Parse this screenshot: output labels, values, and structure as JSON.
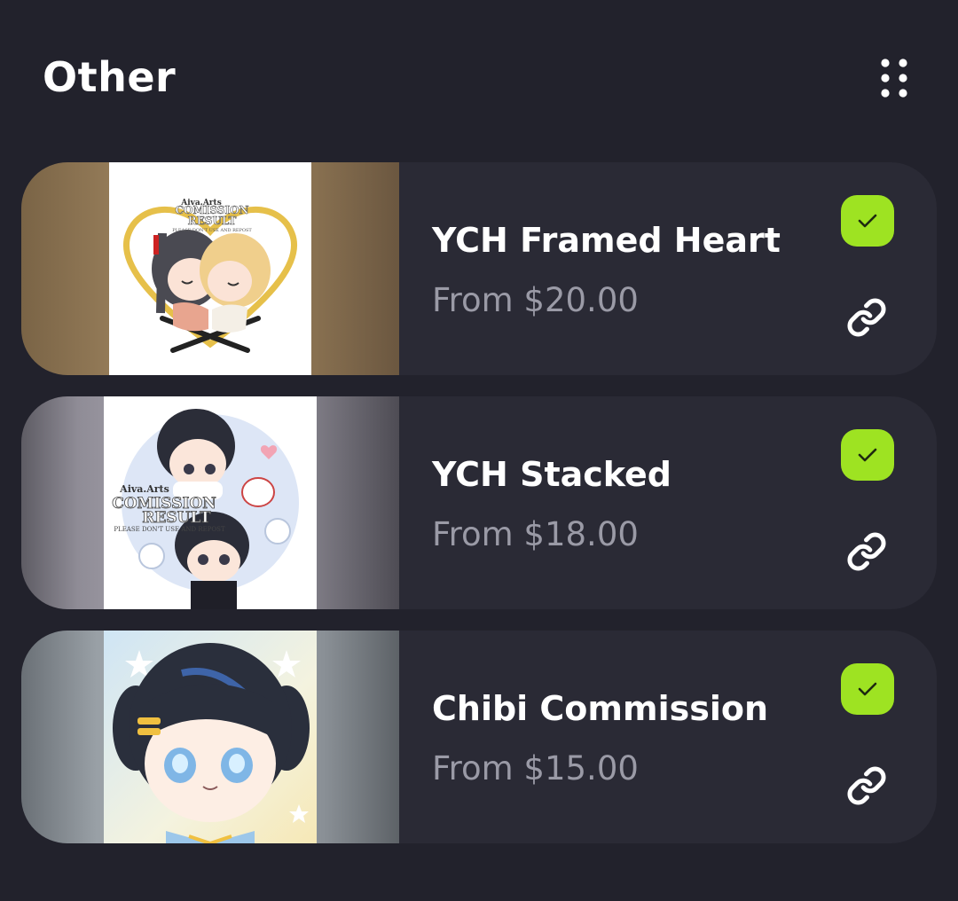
{
  "section": {
    "title": "Other",
    "menu_icon": "grid-dots-icon"
  },
  "colors": {
    "background": "#22222c",
    "card": "#2a2a35",
    "accent_check": "#9ee322",
    "title": "#ffffff",
    "price": "#9a9aa6"
  },
  "items": [
    {
      "title": "YCH Framed Heart",
      "price": "From $20.00",
      "selected": true,
      "thumbnail_text": [
        "Aiva.Arts",
        "COMISSION",
        "RESULT",
        "PLEASE DON'T USE AND REPOST"
      ]
    },
    {
      "title": "YCH Stacked",
      "price": "From $18.00",
      "selected": true,
      "thumbnail_text": [
        "Aiva.Arts",
        "COMISSION",
        "RESULT",
        "PLEASE DON'T USE AND REPOST"
      ]
    },
    {
      "title": "Chibi Commission",
      "price": "From $15.00",
      "selected": true,
      "thumbnail_text": []
    }
  ]
}
